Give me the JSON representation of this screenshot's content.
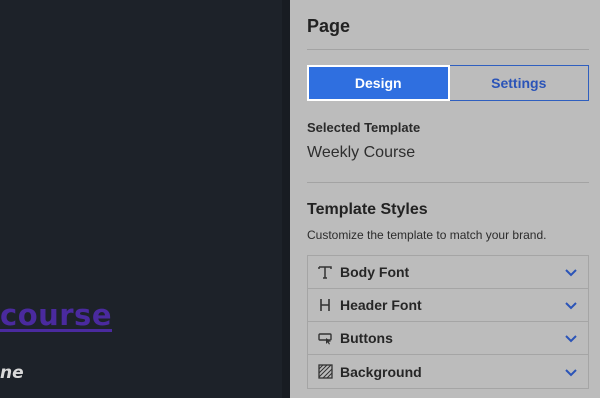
{
  "canvas": {
    "link_text": "course",
    "italic_text": "ne"
  },
  "panel": {
    "title": "Page",
    "tabs": [
      {
        "label": "Design",
        "active": true
      },
      {
        "label": "Settings",
        "active": false
      }
    ],
    "selected_template_label": "Selected Template",
    "selected_template_value": "Weekly Course",
    "styles_title": "Template Styles",
    "styles_description": "Customize the template to match your brand.",
    "style_items": [
      {
        "label": "Body Font",
        "icon": "text-icon"
      },
      {
        "label": "Header Font",
        "icon": "heading-icon"
      },
      {
        "label": "Buttons",
        "icon": "button-cursor-icon"
      },
      {
        "label": "Background",
        "icon": "pattern-icon"
      }
    ]
  },
  "colors": {
    "accent": "#2f6fe0",
    "link": "#4a2a9e",
    "panel_bg": "#bcbcbc",
    "canvas_bg": "#1d2229"
  }
}
